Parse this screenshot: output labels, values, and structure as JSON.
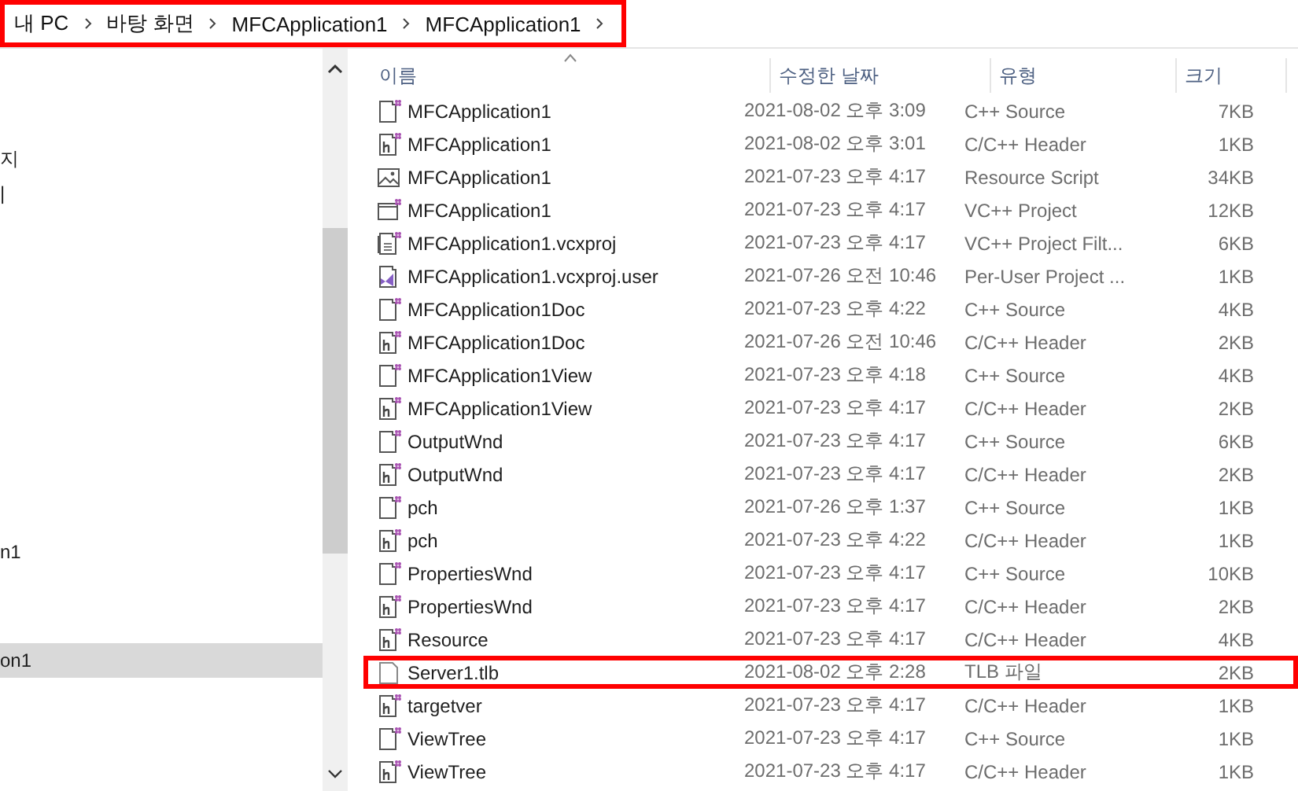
{
  "breadcrumb": {
    "annotated": true,
    "items": [
      {
        "label": "내 PC"
      },
      {
        "label": "바탕 화면"
      },
      {
        "label": "MFCApplication1"
      },
      {
        "label": "MFCApplication1"
      }
    ]
  },
  "nav_pane": {
    "items": [
      {
        "label": "지",
        "selected": false
      },
      {
        "label": "|",
        "selected": false
      },
      {
        "label": "n1",
        "selected": false
      },
      {
        "label": "on1",
        "selected": true
      }
    ]
  },
  "file_list": {
    "columns": [
      "이름",
      "수정한 날짜",
      "유형",
      "크기"
    ],
    "rows": [
      {
        "kind": "cpp",
        "name": "MFCApplication1",
        "modified": "2021-08-02 오후 3:09",
        "type": "C++ Source",
        "size": "7KB",
        "annotated": false
      },
      {
        "kind": "header",
        "name": "MFCApplication1",
        "modified": "2021-08-02 오후 3:01",
        "type": "C/C++ Header",
        "size": "1KB",
        "annotated": false
      },
      {
        "kind": "resource",
        "name": "MFCApplication1",
        "modified": "2021-07-23 오후 4:17",
        "type": "Resource Script",
        "size": "34KB",
        "annotated": false
      },
      {
        "kind": "project",
        "name": "MFCApplication1",
        "modified": "2021-07-23 오후 4:17",
        "type": "VC++ Project",
        "size": "12KB",
        "annotated": false
      },
      {
        "kind": "filters",
        "name": "MFCApplication1.vcxproj",
        "modified": "2021-07-23 오후 4:17",
        "type": "VC++ Project Filt...",
        "size": "6KB",
        "annotated": false
      },
      {
        "kind": "user",
        "name": "MFCApplication1.vcxproj.user",
        "modified": "2021-07-26 오전 10:46",
        "type": "Per-User Project ...",
        "size": "1KB",
        "annotated": false
      },
      {
        "kind": "cpp",
        "name": "MFCApplication1Doc",
        "modified": "2021-07-23 오후 4:22",
        "type": "C++ Source",
        "size": "4KB",
        "annotated": false
      },
      {
        "kind": "header",
        "name": "MFCApplication1Doc",
        "modified": "2021-07-26 오전 10:46",
        "type": "C/C++ Header",
        "size": "2KB",
        "annotated": false
      },
      {
        "kind": "cpp",
        "name": "MFCApplication1View",
        "modified": "2021-07-23 오후 4:18",
        "type": "C++ Source",
        "size": "4KB",
        "annotated": false
      },
      {
        "kind": "header",
        "name": "MFCApplication1View",
        "modified": "2021-07-23 오후 4:17",
        "type": "C/C++ Header",
        "size": "2KB",
        "annotated": false
      },
      {
        "kind": "cpp",
        "name": "OutputWnd",
        "modified": "2021-07-23 오후 4:17",
        "type": "C++ Source",
        "size": "6KB",
        "annotated": false
      },
      {
        "kind": "header",
        "name": "OutputWnd",
        "modified": "2021-07-23 오후 4:17",
        "type": "C/C++ Header",
        "size": "2KB",
        "annotated": false
      },
      {
        "kind": "cpp",
        "name": "pch",
        "modified": "2021-07-26 오후 1:37",
        "type": "C++ Source",
        "size": "1KB",
        "annotated": false
      },
      {
        "kind": "header",
        "name": "pch",
        "modified": "2021-07-23 오후 4:22",
        "type": "C/C++ Header",
        "size": "1KB",
        "annotated": false
      },
      {
        "kind": "cpp",
        "name": "PropertiesWnd",
        "modified": "2021-07-23 오후 4:17",
        "type": "C++ Source",
        "size": "10KB",
        "annotated": false
      },
      {
        "kind": "header",
        "name": "PropertiesWnd",
        "modified": "2021-07-23 오후 4:17",
        "type": "C/C++ Header",
        "size": "2KB",
        "annotated": false
      },
      {
        "kind": "header",
        "name": "Resource",
        "modified": "2021-07-23 오후 4:17",
        "type": "C/C++ Header",
        "size": "4KB",
        "annotated": false
      },
      {
        "kind": "blank",
        "name": "Server1.tlb",
        "modified": "2021-08-02 오후 2:28",
        "type": "TLB 파일",
        "size": "2KB",
        "annotated": true
      },
      {
        "kind": "header",
        "name": "targetver",
        "modified": "2021-07-23 오후 4:17",
        "type": "C/C++ Header",
        "size": "1KB",
        "annotated": false
      },
      {
        "kind": "cpp",
        "name": "ViewTree",
        "modified": "2021-07-23 오후 4:17",
        "type": "C++ Source",
        "size": "1KB",
        "annotated": false
      },
      {
        "kind": "header",
        "name": "ViewTree",
        "modified": "2021-07-23 오후 4:17",
        "type": "C/C++ Header",
        "size": "1KB",
        "annotated": false
      }
    ]
  }
}
